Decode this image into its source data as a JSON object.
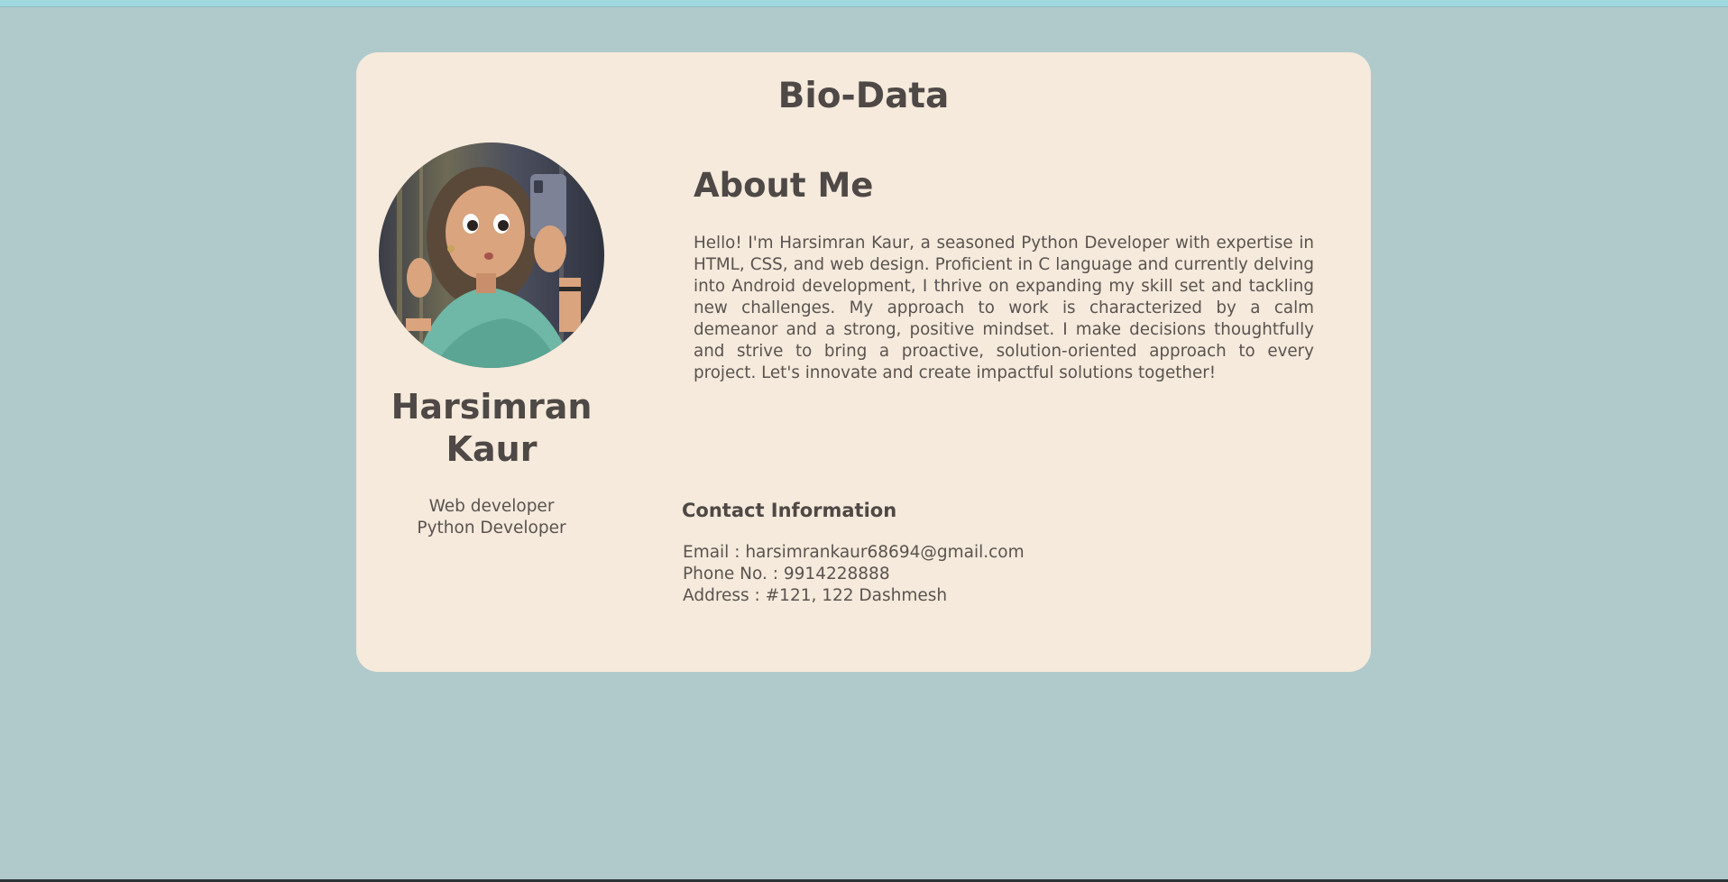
{
  "page": {
    "title": "Bio-Data"
  },
  "profile": {
    "name": "Harsimran Kaur",
    "roles": [
      "Web developer",
      "Python Developer"
    ],
    "avatar_icon": "profile-avatar-illustration"
  },
  "about": {
    "heading": "About Me",
    "text": "Hello! I'm Harsimran Kaur, a seasoned Python Developer with expertise in HTML, CSS, and web design. Proficient in C language and currently delving into Android development, I thrive on expanding my skill set and tackling new challenges. My approach to work is characterized by a calm demeanor and a strong, positive mindset. I make decisions thoughtfully and strive to bring a proactive, solution-oriented approach to every project. Let's innovate and create impactful solutions together!"
  },
  "contact": {
    "heading": "Contact Information",
    "email": "Email : harsimrankaur68694@gmail.com",
    "phone": "Phone No. : 9914228888",
    "address": "Address : #121, 122 Dashmesh"
  },
  "colors": {
    "background": "#b0cacb",
    "card": "#f5eadb",
    "text": "#4e4846",
    "top_strip": "#9fd9df"
  }
}
